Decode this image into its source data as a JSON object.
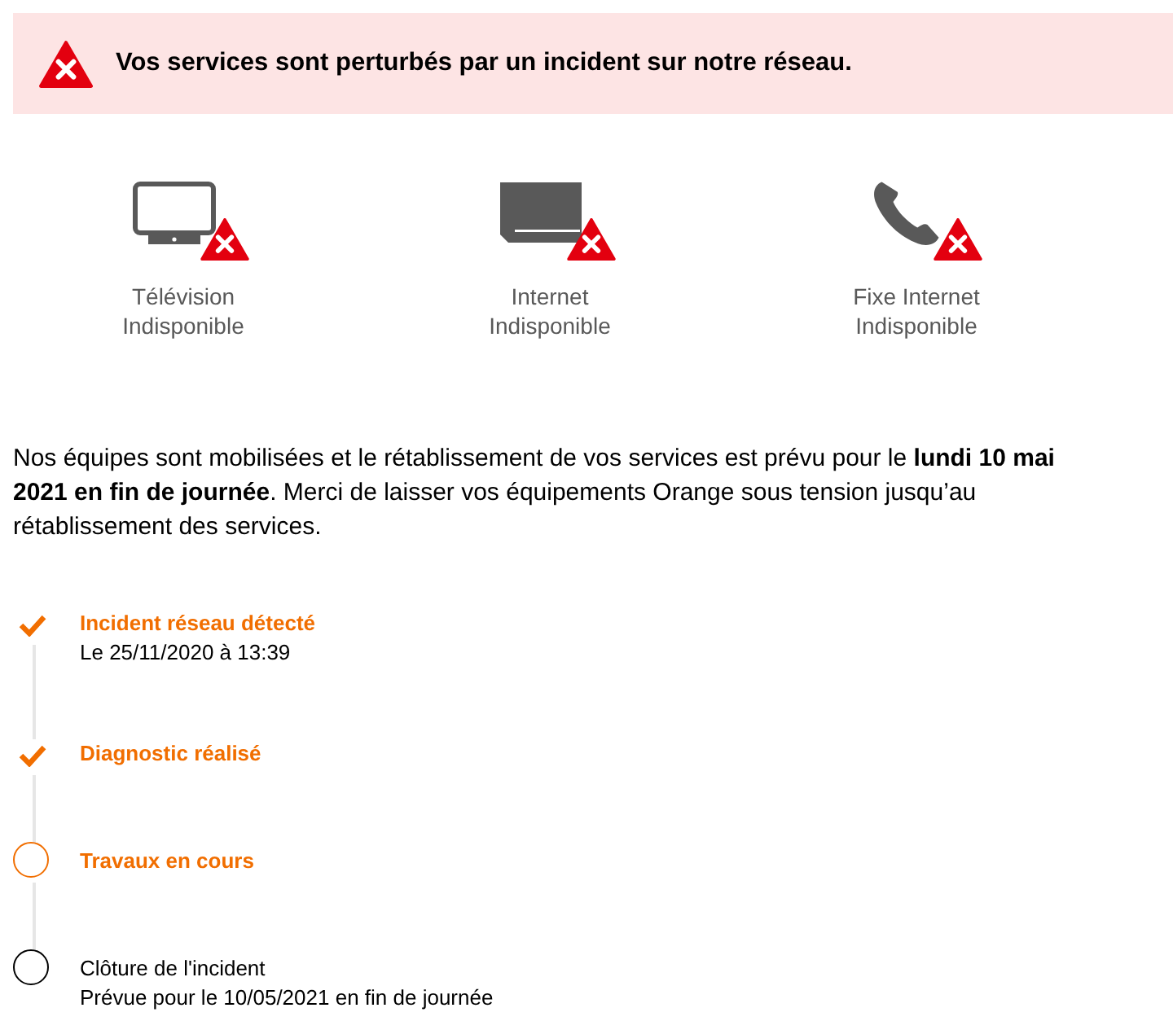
{
  "alert": {
    "message": "Vos services sont perturbés par un incident sur notre réseau."
  },
  "services": [
    {
      "kind": "tv",
      "name": "Télévision",
      "status": "Indisponible",
      "available": false
    },
    {
      "kind": "box",
      "name": "Internet",
      "status": "Indisponible",
      "available": false
    },
    {
      "kind": "phone",
      "name": "Fixe Internet",
      "status": "Indisponible",
      "available": false
    }
  ],
  "message": "Nos équipes sont mobilisées et le rétablissement de vos services est prévu pour le **lundi 10 mai 2021 en fin de journée**. Merci de laisser vos équipements Orange sous tension jusqu’au rétablissement des services.",
  "steps": [
    {
      "title": "Incident réseau détecté",
      "detail": "Le 25/11/2020 à 13:39",
      "kind": "done"
    },
    {
      "title": "Diagnostic réalisé",
      "kind": "done"
    },
    {
      "title": "Travaux en cours",
      "kind": "current"
    },
    {
      "title": "Clôture de l'incident",
      "detail": "Prévue pour le 10/05/2021 en fin de journée",
      "kind": "pending"
    }
  ]
}
